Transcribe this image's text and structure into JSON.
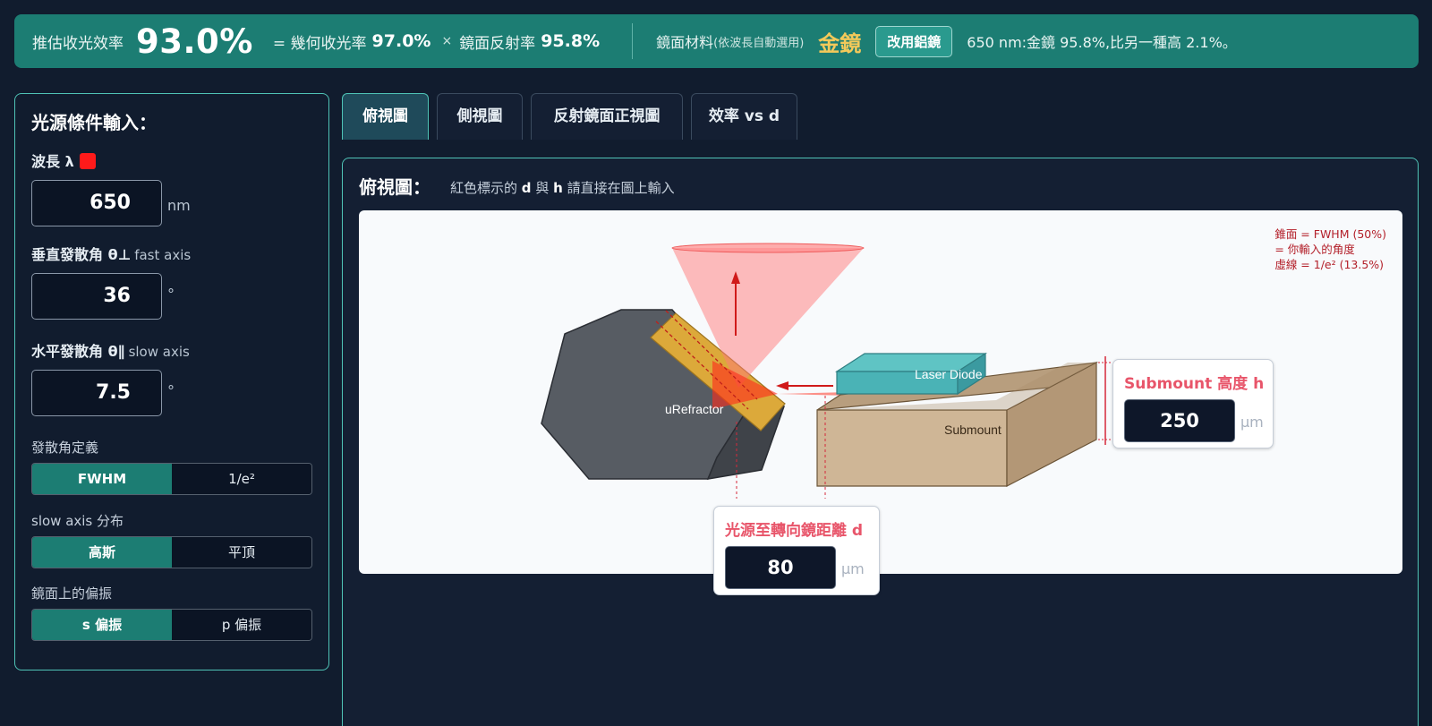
{
  "banner": {
    "efficiency_label": "推估收光效率",
    "efficiency_value": "93.0%",
    "eq_label": "= 幾何收光率",
    "geo_value": "97.0%",
    "times": "×",
    "mirror_label": "鏡面反射率",
    "mirror_value": "95.8%",
    "material_label": "鏡面材料",
    "material_sub": "(依波長自動選用)",
    "material_value": "金鏡",
    "switch_button": "改用鋁鏡",
    "note": "650 nm:金鏡 95.8%,比另一種高 2.1%。",
    "colors": {
      "banner_bg": "#1c7d73",
      "gold": "#f3c95a"
    }
  },
  "left": {
    "title": "光源條件輸入：",
    "wavelength": {
      "label": "波長 λ",
      "value": "650",
      "unit": "nm",
      "swatch_color": "#ff1a1a"
    },
    "fast_axis": {
      "label": "垂直發散角 θ⊥",
      "sub": "fast axis",
      "value": "36",
      "unit": "°"
    },
    "slow_axis": {
      "label": "水平發散角 θ∥",
      "sub": "slow axis",
      "value": "7.5",
      "unit": "°"
    },
    "divergence_def": {
      "label": "發散角定義",
      "options": [
        "FWHM",
        "1/e²"
      ],
      "selected": "FWHM"
    },
    "slow_dist": {
      "label": "slow axis 分布",
      "options": [
        "高斯",
        "平頂"
      ],
      "selected": "高斯"
    },
    "polarization": {
      "label": "鏡面上的偏振",
      "options": [
        "s 偏振",
        "p 偏振"
      ],
      "selected": "s 偏振"
    }
  },
  "tabs": [
    {
      "label": "俯視圖",
      "active": true
    },
    {
      "label": "側視圖",
      "active": false
    },
    {
      "label": "反射鏡面正視圖",
      "active": false
    },
    {
      "label": "效率 vs d",
      "active": false
    }
  ],
  "main": {
    "title": "俯視圖：",
    "hint_pre": "紅色標示的",
    "hint_d": "d",
    "hint_mid": "與",
    "hint_h": "h",
    "hint_post": "請直接在圖上輸入",
    "legend": [
      "錐面 = FWHM (50%)",
      "= 你輸入的角度",
      "虛線 = 1/e² (13.5%)"
    ],
    "labels": {
      "refractor": "uRefractor",
      "laser": "Laser Diode",
      "submount": "Submount"
    },
    "d_input": {
      "label": "光源至轉向鏡距離 d",
      "value": "80",
      "unit": "µm"
    },
    "h_input": {
      "label": "Submount 高度 h",
      "value": "250",
      "unit": "µm"
    }
  }
}
